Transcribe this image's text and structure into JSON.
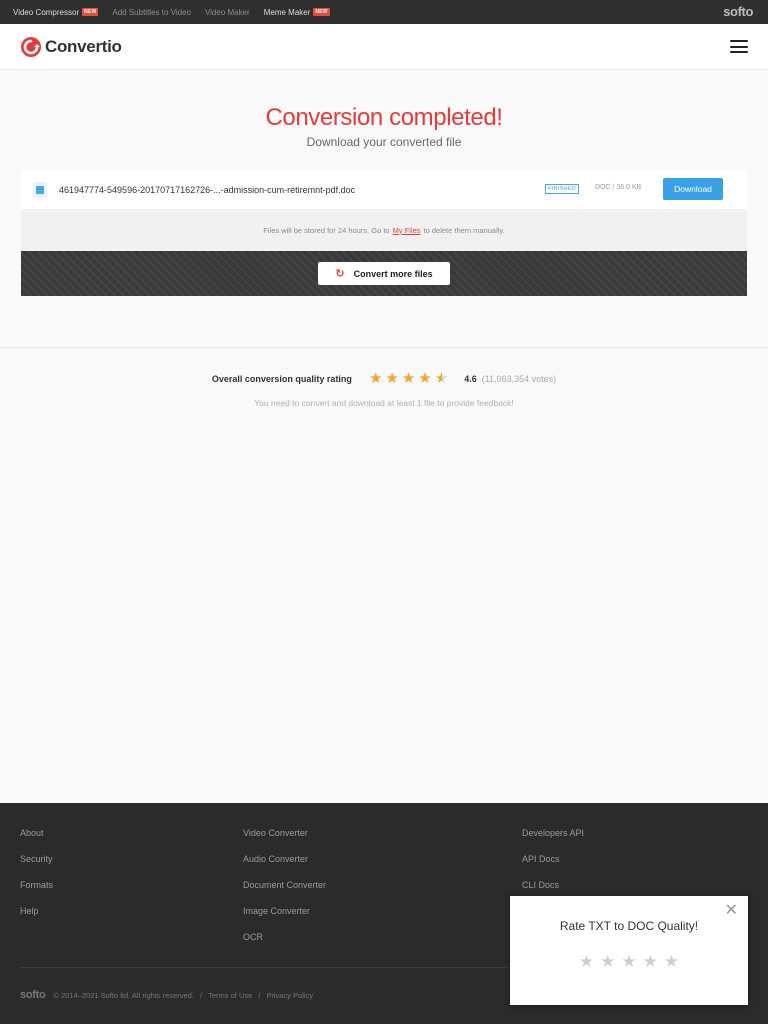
{
  "topbar": {
    "links": [
      {
        "label": "Video Compressor",
        "badge": "NEW"
      },
      {
        "label": "Add Subtitles to Video",
        "badge": ""
      },
      {
        "label": "Video Maker",
        "badge": ""
      },
      {
        "label": "Meme Maker",
        "badge": "NEW"
      }
    ],
    "brand": "softo"
  },
  "header": {
    "logo_text": "Convertio",
    "logo_color": "#e53b3b",
    "menu_icon": "hamburger-icon"
  },
  "hero": {
    "title": "Conversion completed!",
    "subtitle": "Download your converted file"
  },
  "file": {
    "name": "461947774-549596-20170717162726-...-admission-cum-retiremnt-pdf.doc",
    "status": "FINISHED",
    "meta": "DOC / 36.0 KB",
    "download_label": "Download",
    "icon": "document-icon"
  },
  "storage": {
    "before": "Files will be stored for 24 hours. Go to",
    "link": "My Files",
    "after": "to delete them manually."
  },
  "convert_more": {
    "label": "Convert more files",
    "icon": "refresh-icon"
  },
  "rating": {
    "label": "Overall conversion quality rating",
    "value": "4.6",
    "votes": "(11,063,354 votes)",
    "stars_value": 4.6,
    "feedback": "You need to convert and download at least 1 file to provide feedback!"
  },
  "footer": {
    "col1": [
      "About",
      "Security",
      "Formats",
      "Help"
    ],
    "col2": [
      "Video Converter",
      "Audio Converter",
      "Document Converter",
      "Image Converter",
      "OCR"
    ],
    "col3": [
      "Developers API",
      "API Docs",
      "CLI Docs"
    ],
    "brand": "softo",
    "copyright": "© 2014–2021 Softo ltd. All rights reserved.",
    "separator": "/",
    "terms": "Terms of Use",
    "privacy": "Privacy Policy"
  },
  "popup": {
    "title": "Rate TXT to DOC Quality!",
    "close_icon": "close-icon",
    "stars": 5
  },
  "colors": {
    "accent_red": "#e53b3b",
    "download_blue": "#3aa0e8",
    "star_gold": "#f5a623"
  }
}
